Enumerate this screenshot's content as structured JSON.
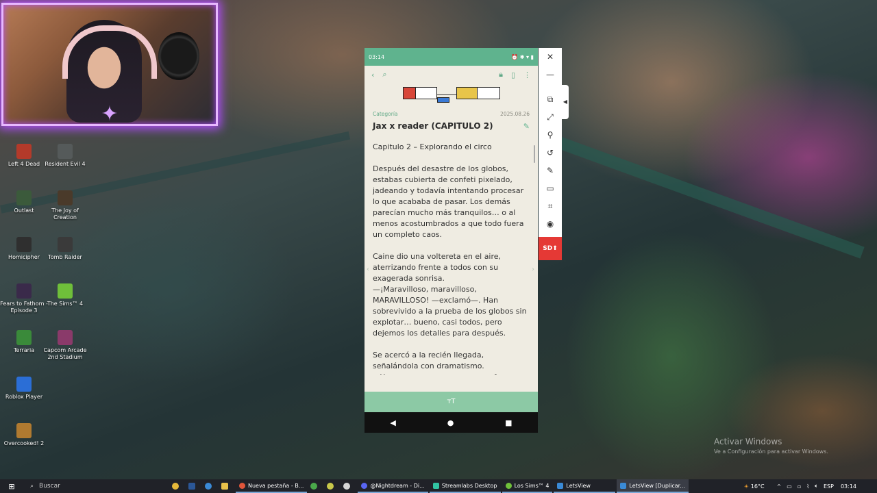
{
  "desktop_icons": [
    {
      "label": "Left 4 Dead",
      "color": "#b33a2a"
    },
    {
      "label": "Resident Evil 4",
      "color": "#555a5a"
    },
    {
      "label": "Outlast",
      "color": "#3b5a3b"
    },
    {
      "label": "The Joy of Creation",
      "color": "#4a3a2a"
    },
    {
      "label": "Homicipher",
      "color": "#2f2f2f"
    },
    {
      "label": "Tomb Raider",
      "color": "#3a3a3a"
    },
    {
      "label": "Fears to Fathom - Episode 3",
      "color": "#3a2a4a"
    },
    {
      "label": "The Sims™ 4",
      "color": "#6fbf3a"
    },
    {
      "label": "Terraria",
      "color": "#3a8a3a"
    },
    {
      "label": "Capcom Arcade 2nd Stadium",
      "color": "#8a3a6a"
    },
    {
      "label": "Roblox Player",
      "color": "#2b6ed6"
    },
    {
      "label": "Overcooked! 2",
      "color": "#b07a30"
    }
  ],
  "phone": {
    "status_time": "03:14",
    "status_icons": "⏰ ✱ ▾ ▮",
    "post": {
      "category": "Categoría",
      "date": "2025.08.26",
      "title": "Jax x reader (CAPITULO 2)",
      "paragraphs": [
        "Capitulo 2 – Explorando el circo",
        "Después del desastre de los globos, estabas cubierta de confeti pixelado, jadeando y todavía intentando procesar lo que acababa de pasar. Los demás parecían mucho más tranquilos… o al menos acostumbrados a que todo fuera un completo caos.",
        "Caine dio una voltereta en el aire, aterrizando frente a todos con su exagerada sonrisa.\n—¡Maravilloso, maravilloso, MARAVILLOSO! —exclamó—. Han sobrevivido a la prueba de los globos sin explotar… bueno, casi todos, pero dejemos los detalles para después.",
        "Se acercó a la recién llegada, señalándola con dramatismo.\n—Y como recompensa por su esfuerzo"
      ]
    },
    "font_button": "ᴛT",
    "nav": {
      "back": "◀",
      "home": "●",
      "recent": "■"
    }
  },
  "tools_panel": {
    "sd_label": "SD⬆"
  },
  "watermark": {
    "line1": "Activar Windows",
    "line2": "Ve a Configuración para activar Windows."
  },
  "taskbar": {
    "search_placeholder": "Buscar",
    "apps": [
      {
        "label": "Nueva pestaña - B...",
        "color": "#e0553a",
        "active": false
      },
      {
        "label": "@Nightdream - Di...",
        "color": "#5865f2",
        "active": false
      },
      {
        "label": "Streamlabs Desktop",
        "color": "#31c3a2",
        "active": false
      },
      {
        "label": "Los Sims™ 4",
        "color": "#6fbf3a",
        "active": false
      },
      {
        "label": "LetsView",
        "color": "#3a8ad6",
        "active": false
      },
      {
        "label": "LetsView [Duplicar...",
        "color": "#3a8ad6",
        "active": true
      }
    ],
    "weather": "16°C",
    "language": "ESP",
    "clock": "03:14"
  }
}
